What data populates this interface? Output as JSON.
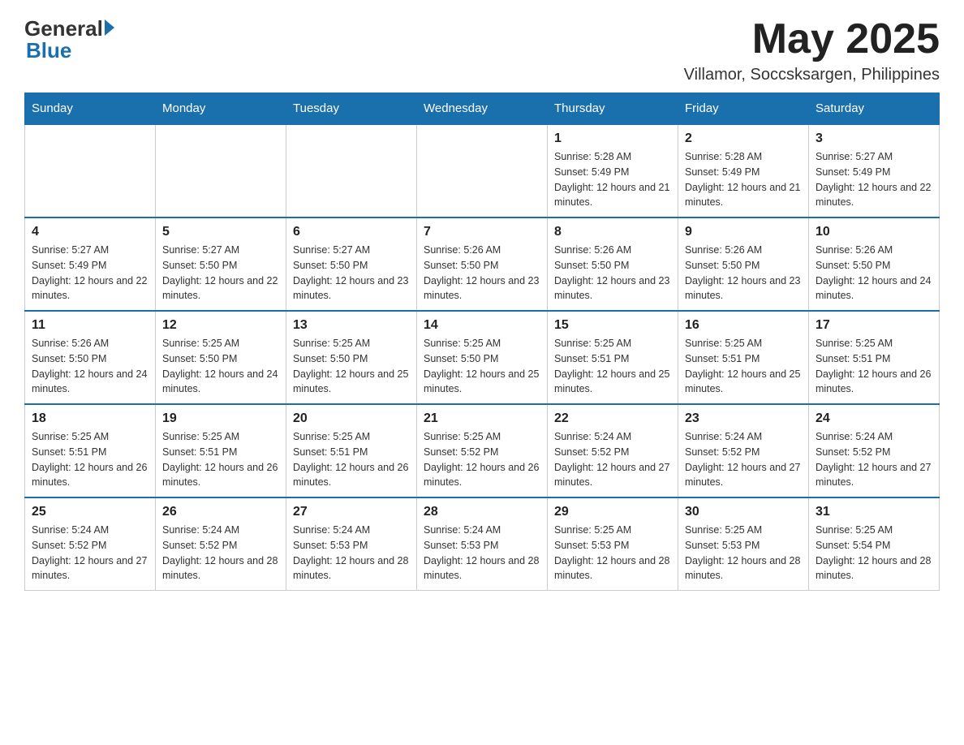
{
  "header": {
    "logo_general": "General",
    "logo_blue": "Blue",
    "month_title": "May 2025",
    "location": "Villamor, Soccsksargen, Philippines"
  },
  "days_of_week": [
    "Sunday",
    "Monday",
    "Tuesday",
    "Wednesday",
    "Thursday",
    "Friday",
    "Saturday"
  ],
  "weeks": [
    {
      "days": [
        {
          "number": "",
          "info": ""
        },
        {
          "number": "",
          "info": ""
        },
        {
          "number": "",
          "info": ""
        },
        {
          "number": "",
          "info": ""
        },
        {
          "number": "1",
          "info": "Sunrise: 5:28 AM\nSunset: 5:49 PM\nDaylight: 12 hours and 21 minutes."
        },
        {
          "number": "2",
          "info": "Sunrise: 5:28 AM\nSunset: 5:49 PM\nDaylight: 12 hours and 21 minutes."
        },
        {
          "number": "3",
          "info": "Sunrise: 5:27 AM\nSunset: 5:49 PM\nDaylight: 12 hours and 22 minutes."
        }
      ]
    },
    {
      "days": [
        {
          "number": "4",
          "info": "Sunrise: 5:27 AM\nSunset: 5:49 PM\nDaylight: 12 hours and 22 minutes."
        },
        {
          "number": "5",
          "info": "Sunrise: 5:27 AM\nSunset: 5:50 PM\nDaylight: 12 hours and 22 minutes."
        },
        {
          "number": "6",
          "info": "Sunrise: 5:27 AM\nSunset: 5:50 PM\nDaylight: 12 hours and 23 minutes."
        },
        {
          "number": "7",
          "info": "Sunrise: 5:26 AM\nSunset: 5:50 PM\nDaylight: 12 hours and 23 minutes."
        },
        {
          "number": "8",
          "info": "Sunrise: 5:26 AM\nSunset: 5:50 PM\nDaylight: 12 hours and 23 minutes."
        },
        {
          "number": "9",
          "info": "Sunrise: 5:26 AM\nSunset: 5:50 PM\nDaylight: 12 hours and 23 minutes."
        },
        {
          "number": "10",
          "info": "Sunrise: 5:26 AM\nSunset: 5:50 PM\nDaylight: 12 hours and 24 minutes."
        }
      ]
    },
    {
      "days": [
        {
          "number": "11",
          "info": "Sunrise: 5:26 AM\nSunset: 5:50 PM\nDaylight: 12 hours and 24 minutes."
        },
        {
          "number": "12",
          "info": "Sunrise: 5:25 AM\nSunset: 5:50 PM\nDaylight: 12 hours and 24 minutes."
        },
        {
          "number": "13",
          "info": "Sunrise: 5:25 AM\nSunset: 5:50 PM\nDaylight: 12 hours and 25 minutes."
        },
        {
          "number": "14",
          "info": "Sunrise: 5:25 AM\nSunset: 5:50 PM\nDaylight: 12 hours and 25 minutes."
        },
        {
          "number": "15",
          "info": "Sunrise: 5:25 AM\nSunset: 5:51 PM\nDaylight: 12 hours and 25 minutes."
        },
        {
          "number": "16",
          "info": "Sunrise: 5:25 AM\nSunset: 5:51 PM\nDaylight: 12 hours and 25 minutes."
        },
        {
          "number": "17",
          "info": "Sunrise: 5:25 AM\nSunset: 5:51 PM\nDaylight: 12 hours and 26 minutes."
        }
      ]
    },
    {
      "days": [
        {
          "number": "18",
          "info": "Sunrise: 5:25 AM\nSunset: 5:51 PM\nDaylight: 12 hours and 26 minutes."
        },
        {
          "number": "19",
          "info": "Sunrise: 5:25 AM\nSunset: 5:51 PM\nDaylight: 12 hours and 26 minutes."
        },
        {
          "number": "20",
          "info": "Sunrise: 5:25 AM\nSunset: 5:51 PM\nDaylight: 12 hours and 26 minutes."
        },
        {
          "number": "21",
          "info": "Sunrise: 5:25 AM\nSunset: 5:52 PM\nDaylight: 12 hours and 26 minutes."
        },
        {
          "number": "22",
          "info": "Sunrise: 5:24 AM\nSunset: 5:52 PM\nDaylight: 12 hours and 27 minutes."
        },
        {
          "number": "23",
          "info": "Sunrise: 5:24 AM\nSunset: 5:52 PM\nDaylight: 12 hours and 27 minutes."
        },
        {
          "number": "24",
          "info": "Sunrise: 5:24 AM\nSunset: 5:52 PM\nDaylight: 12 hours and 27 minutes."
        }
      ]
    },
    {
      "days": [
        {
          "number": "25",
          "info": "Sunrise: 5:24 AM\nSunset: 5:52 PM\nDaylight: 12 hours and 27 minutes."
        },
        {
          "number": "26",
          "info": "Sunrise: 5:24 AM\nSunset: 5:52 PM\nDaylight: 12 hours and 28 minutes."
        },
        {
          "number": "27",
          "info": "Sunrise: 5:24 AM\nSunset: 5:53 PM\nDaylight: 12 hours and 28 minutes."
        },
        {
          "number": "28",
          "info": "Sunrise: 5:24 AM\nSunset: 5:53 PM\nDaylight: 12 hours and 28 minutes."
        },
        {
          "number": "29",
          "info": "Sunrise: 5:25 AM\nSunset: 5:53 PM\nDaylight: 12 hours and 28 minutes."
        },
        {
          "number": "30",
          "info": "Sunrise: 5:25 AM\nSunset: 5:53 PM\nDaylight: 12 hours and 28 minutes."
        },
        {
          "number": "31",
          "info": "Sunrise: 5:25 AM\nSunset: 5:54 PM\nDaylight: 12 hours and 28 minutes."
        }
      ]
    }
  ]
}
